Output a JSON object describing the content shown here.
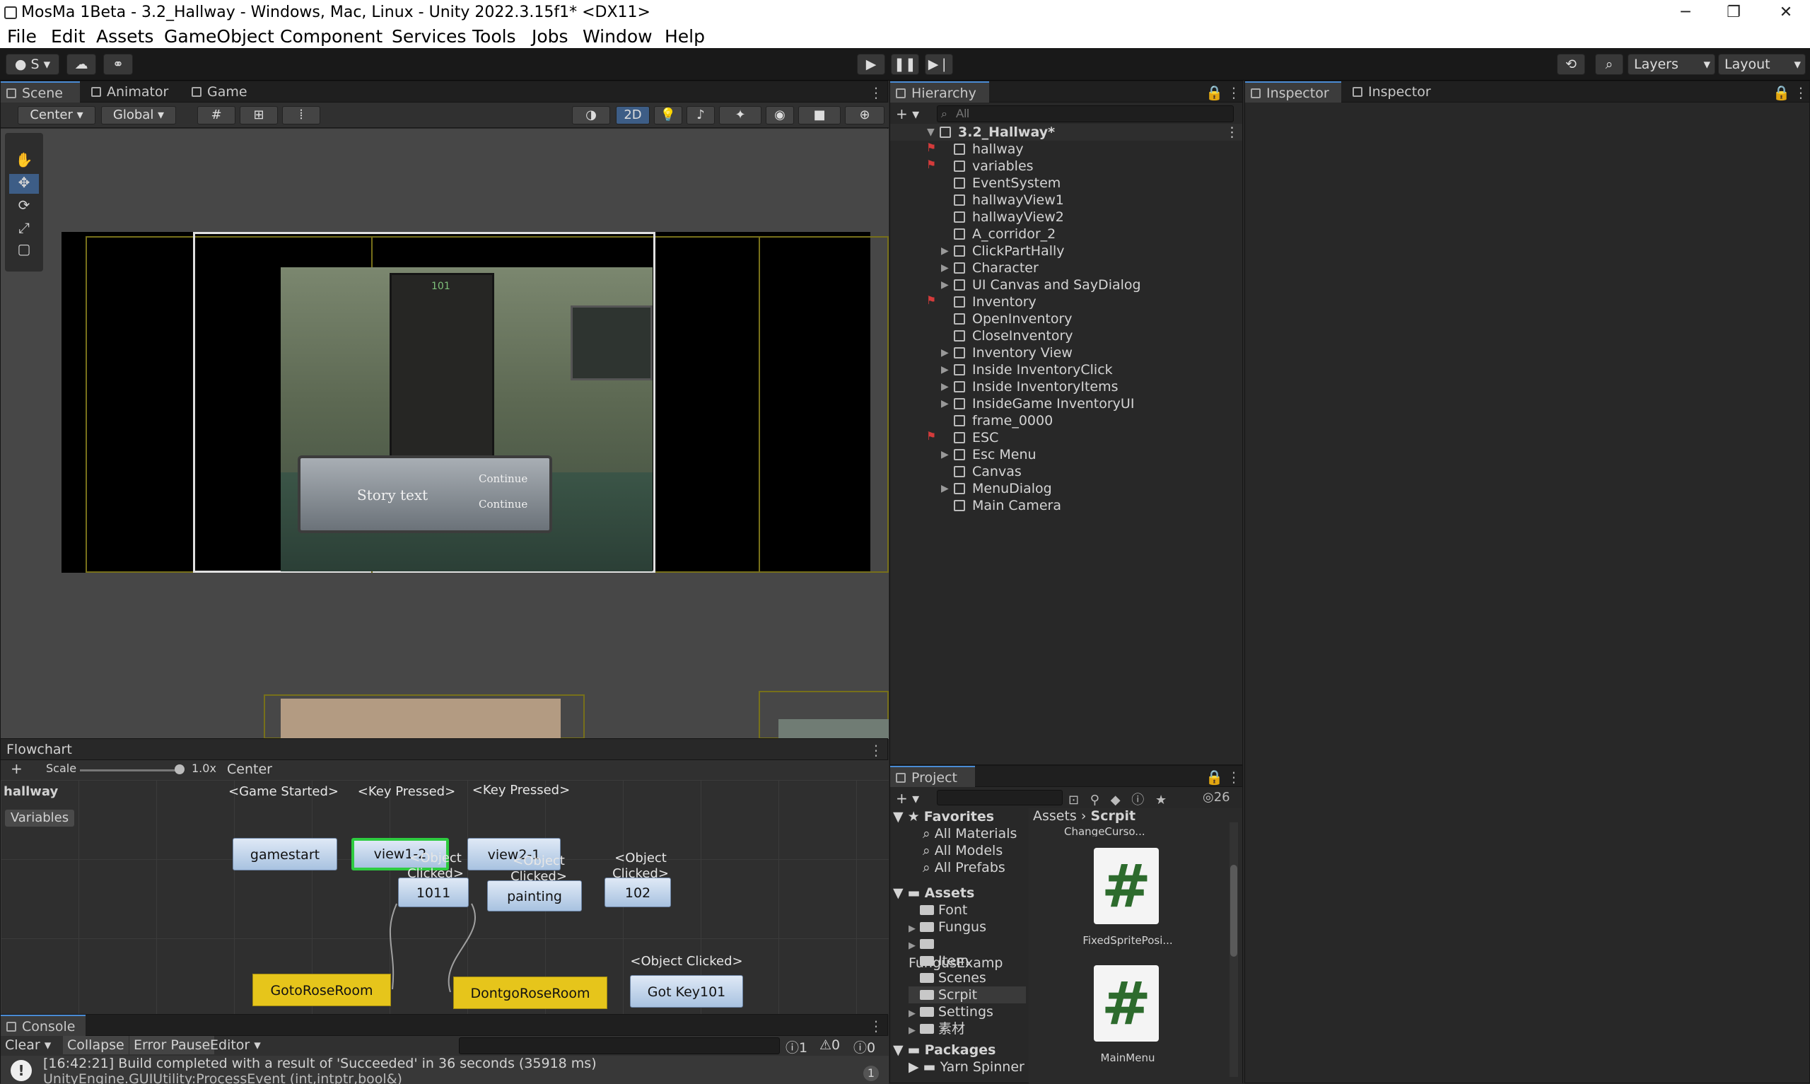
{
  "window": {
    "title": "MosMa 1Beta - 3.2_Hallway - Windows, Mac, Linux - Unity 2022.3.15f1* <DX11>",
    "minimize": "─",
    "maximize": "❐",
    "close": "✕"
  },
  "menu": [
    "File",
    "Edit",
    "Assets",
    "GameObject",
    "Component",
    "Services",
    "Tools",
    "Jobs",
    "Window",
    "Help"
  ],
  "toolbar": {
    "account": "S",
    "layers": "Layers",
    "layout": "Layout"
  },
  "scene": {
    "tabs": [
      "Scene",
      "Animator",
      "Game"
    ],
    "pivot": "Center",
    "space": "Global",
    "mode2d": "2D",
    "door_number": "101",
    "story_text": "Story text",
    "continue1": "Continue",
    "continue2": "Continue"
  },
  "hierarchy": {
    "title": "Hierarchy",
    "search_placeholder": "All",
    "scene_name": "3.2_Hallway*",
    "items": [
      {
        "label": "hallway",
        "expand": false,
        "flag": true
      },
      {
        "label": "variables",
        "expand": false,
        "flag": true
      },
      {
        "label": "EventSystem",
        "expand": false,
        "flag": false
      },
      {
        "label": "hallwayView1",
        "expand": false,
        "flag": false
      },
      {
        "label": "hallwayView2",
        "expand": false,
        "flag": false
      },
      {
        "label": "A_corridor_2",
        "expand": false,
        "flag": false
      },
      {
        "label": "ClickPartHally",
        "expand": true,
        "flag": false
      },
      {
        "label": "Character",
        "expand": true,
        "flag": false
      },
      {
        "label": "UI Canvas and SayDialog",
        "expand": true,
        "flag": false
      },
      {
        "label": "Inventory",
        "expand": false,
        "flag": true
      },
      {
        "label": "OpenInventory",
        "expand": false,
        "flag": false
      },
      {
        "label": "CloseInventory",
        "expand": false,
        "flag": false
      },
      {
        "label": "Inventory View",
        "expand": true,
        "flag": false
      },
      {
        "label": "Inside InventoryClick",
        "expand": true,
        "flag": false
      },
      {
        "label": "Inside InventoryItems",
        "expand": true,
        "flag": false
      },
      {
        "label": "InsideGame InventoryUI",
        "expand": true,
        "flag": false
      },
      {
        "label": "frame_0000",
        "expand": false,
        "flag": false
      },
      {
        "label": "ESC",
        "expand": false,
        "flag": true
      },
      {
        "label": "Esc Menu",
        "expand": true,
        "flag": false
      },
      {
        "label": "Canvas",
        "expand": false,
        "flag": false
      },
      {
        "label": "MenuDialog",
        "expand": true,
        "flag": false
      },
      {
        "label": "Main Camera",
        "expand": false,
        "flag": false
      }
    ]
  },
  "inspector": {
    "tab1": "Inspector",
    "tab2": "Inspector"
  },
  "flowchart": {
    "title": "Flowchart",
    "scale_label": "Scale",
    "scale_value": "1.0x",
    "center": "Center",
    "name": "hallway",
    "variables": "Variables",
    "nodes": [
      {
        "id": "gamestart",
        "label": "gamestart",
        "event": "<Game Started>"
      },
      {
        "id": "view12",
        "label": "view1-2",
        "event": "<Key Pressed>"
      },
      {
        "id": "view21",
        "label": "view2-1",
        "event": "<Key Pressed>"
      },
      {
        "id": "n1011",
        "label": "1011",
        "event": "<Object Clicked>"
      },
      {
        "id": "painting",
        "label": "painting",
        "event": "<Object Clicked>"
      },
      {
        "id": "n102",
        "label": "102",
        "event": "<Object Clicked>"
      },
      {
        "id": "gotokey",
        "label": "Got Key101",
        "event": "<Object Clicked>"
      },
      {
        "id": "goto",
        "label": "GotoRoseRoom",
        "event": ""
      },
      {
        "id": "dontgo",
        "label": "DontgoRoseRoom",
        "event": ""
      }
    ]
  },
  "project": {
    "title": "Project",
    "hidden_count": "26",
    "breadcrumb_root": "Assets",
    "breadcrumb_leaf": "Scrpit",
    "favorites": "Favorites",
    "fav_items": [
      "All Materials",
      "All Models",
      "All Prefabs"
    ],
    "assets": "Assets",
    "asset_folders": [
      "Font",
      "Fungus",
      "FungusExamp",
      "Item",
      "Scenes",
      "Scrpit",
      "Settings",
      "素材"
    ],
    "packages": "Packages",
    "package_items": [
      "Yarn Spinner"
    ],
    "files": [
      "ChangeCurso...",
      "FixedSpritePosi...",
      "MainMenu"
    ]
  },
  "console": {
    "title": "Console",
    "clear": "Clear",
    "collapse": "Collapse",
    "error_pause": "Error Pause",
    "editor": "Editor",
    "count_msg": "1",
    "count_warn": "0",
    "count_err": "0",
    "line1": "[16:42:21] Build completed with a result of 'Succeeded' in 36 seconds (35918 ms)",
    "line2": "UnityEngine.GUIUtility:ProcessEvent (int,intptr,bool&)",
    "line_count": "1"
  }
}
